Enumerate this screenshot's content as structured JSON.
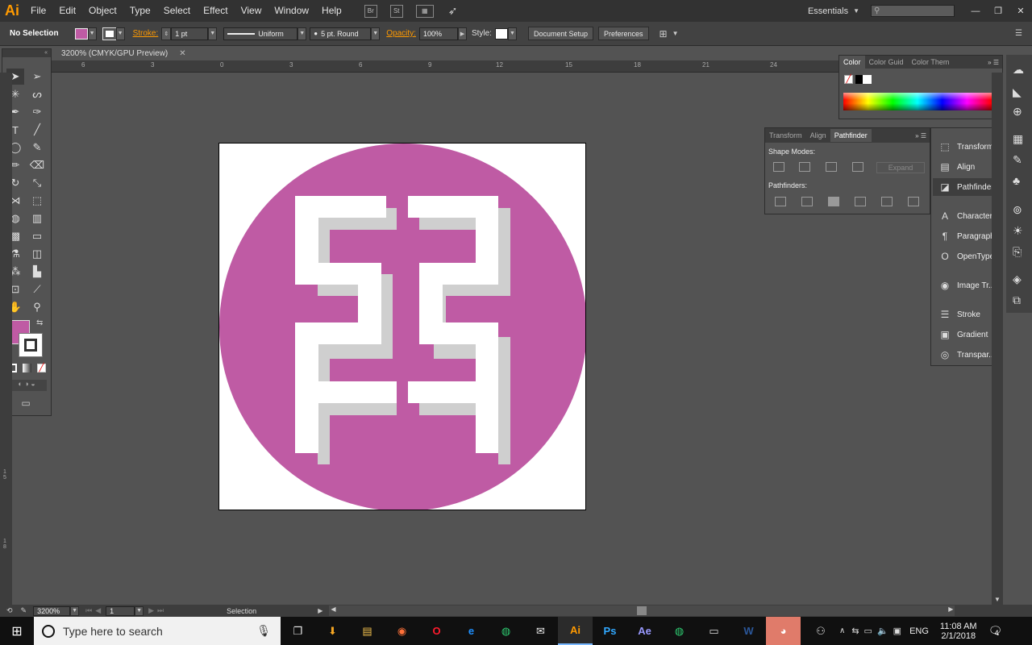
{
  "app": {
    "logo": "Ai"
  },
  "menu": [
    "File",
    "Edit",
    "Object",
    "Type",
    "Select",
    "Effect",
    "View",
    "Window",
    "Help"
  ],
  "toolbar_icons": {
    "bridge": "Br",
    "stock": "St"
  },
  "workspace": {
    "label": "Essentials"
  },
  "control": {
    "selection": "No Selection",
    "stroke_label": "Stroke:",
    "stroke_weight": "1 pt",
    "profile": "Uniform",
    "brush": "5 pt. Round",
    "opacity_label": "Opacity:",
    "opacity_value": "100%",
    "style_label": "Style:",
    "doc_setup": "Document Setup",
    "preferences": "Preferences"
  },
  "document": {
    "tab": "3200% (CMYK/GPU Preview)"
  },
  "ruler": {
    "ticks": [
      "6",
      "3",
      "0",
      "3",
      "6",
      "9",
      "12",
      "15",
      "18",
      "21",
      "24"
    ],
    "vticks": [
      "1\n5",
      "1\n8"
    ]
  },
  "color_panel": {
    "tabs": [
      "Color",
      "Color Guid",
      "Color Them"
    ]
  },
  "pathfinder_panel": {
    "tabs": [
      "Transform",
      "Align",
      "Pathfinder"
    ],
    "shape_modes": "Shape Modes:",
    "pathfinders": "Pathfinders:",
    "expand": "Expand"
  },
  "side_panels": [
    "Transform",
    "Align",
    "Pathfinder",
    "Character",
    "Paragraph",
    "OpenType",
    "Image Tr...",
    "Stroke",
    "Gradient",
    "Transpar..."
  ],
  "statusbar": {
    "zoom": "3200%",
    "artboard": "1",
    "tool": "Selection"
  },
  "taskbar": {
    "search_placeholder": "Type here to search",
    "lang": "ENG",
    "time": "11:08 AM",
    "date": "2/1/2018",
    "notif_count": "4"
  },
  "colors": {
    "fill": "#bf5ba4",
    "accent": "#ff9a00"
  }
}
